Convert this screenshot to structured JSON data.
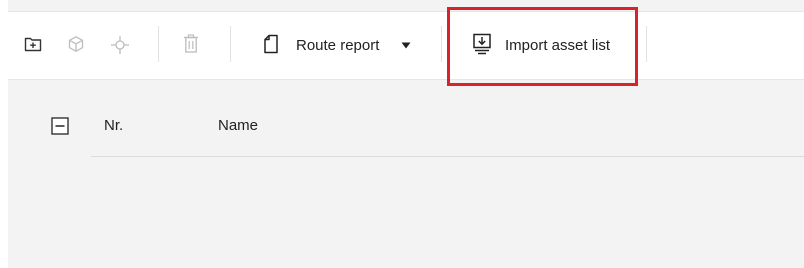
{
  "toolbar": {
    "icons": {
      "new_folder": "folder-plus-icon",
      "asset": "cube-icon",
      "locate": "crosshair-icon",
      "delete": "trash-icon",
      "route_report": "document-icon",
      "dropdown": "caret-down-icon",
      "import": "import-download-icon"
    },
    "route_report_label": "Route report",
    "import_label": "Import asset list"
  },
  "table": {
    "columns": [
      "Nr.",
      "Name"
    ]
  },
  "colors": {
    "highlight": "#d6232c",
    "background": "#f3f3f3",
    "toolbar": "#ffffff"
  }
}
